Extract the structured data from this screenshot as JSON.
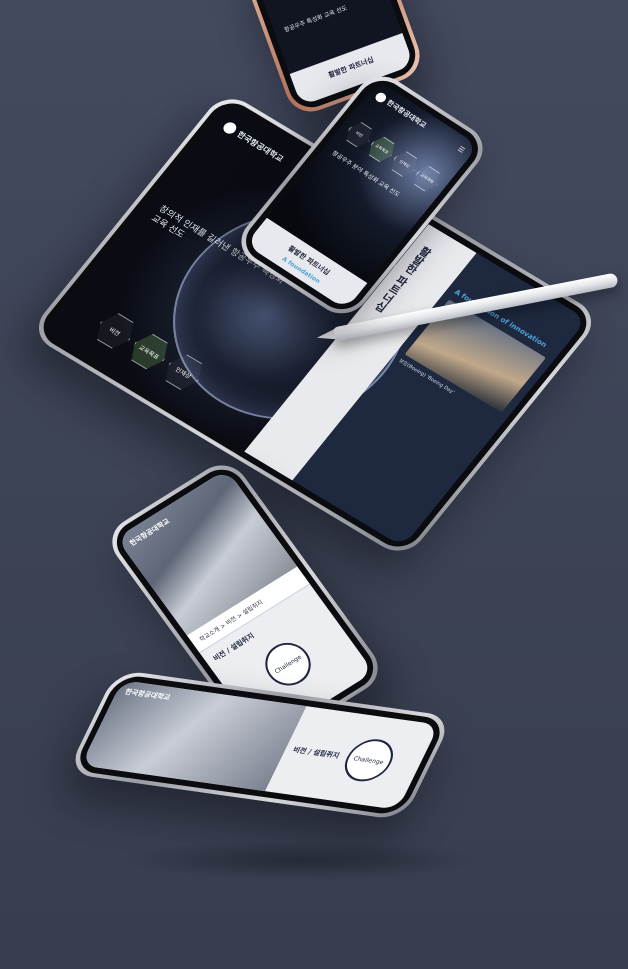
{
  "scene": {
    "background_color": "#3f4557",
    "accent_blue": "#4fa3d6",
    "navy": "#1e2940"
  },
  "tablet": {
    "brand": "한국항공대학교",
    "headline": "창의적 인재를 길러낸 항공우주 특성화 교육 선도",
    "hexes": [
      "비전",
      "교육목표",
      "인재상"
    ],
    "panel_title": "활발한 파트너십",
    "foundation": "A foundation of innovation",
    "photo_caption": "보잉(Boeing) 'Boeing Day'"
  },
  "phone_top": {
    "brand": "한국항공대학교",
    "hexes": [
      "비전",
      "교육목표",
      "인재상",
      "교육과정"
    ],
    "copy": "항공우주 분야 특성화 교육 선도",
    "cta": "활발한 파트너십",
    "footer": "A foundation"
  },
  "phone_corner": {
    "copy": "항공우주 특성화 교육 선도",
    "cta": "활발한 파트너십"
  },
  "phone_mid": {
    "brand": "한국항공대학교",
    "crumb": "학교소개 > 비전 > 설립취지",
    "section": "비전 / 설립취지",
    "badge": "Challenge"
  },
  "phone_bot": {
    "brand": "한국항공대학교",
    "section": "비전 / 설립취지",
    "badge": "Challenge"
  }
}
